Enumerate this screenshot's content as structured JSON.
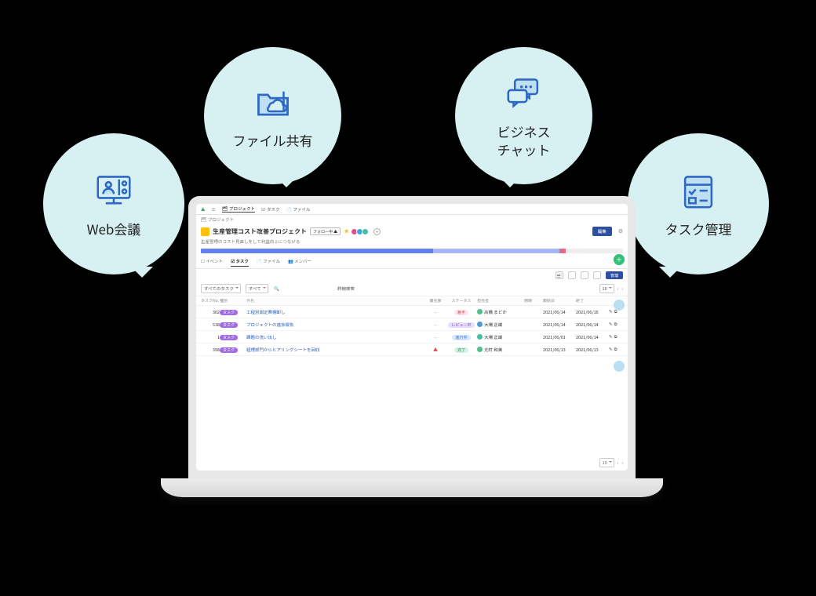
{
  "bubbles": {
    "web": "Web会議",
    "file": "ファイル共有",
    "chat": "ビジネス\nチャット",
    "task": "タスク管理"
  },
  "topnav": {
    "project": "プロジェクト",
    "task": "タスク",
    "file": "ファイル"
  },
  "breadcrumb": "プロジェクト",
  "project": {
    "title": "生産管理コスト改善プロジェクト",
    "follow_btn": "フォロー中 ▲",
    "description": "生産管理のコスト見直しをして利益向上につなげる",
    "edit_btn": "編集"
  },
  "subtabs": {
    "event": "イベント",
    "task": "タスク",
    "file": "ファイル",
    "member": "メンバー"
  },
  "toolbar": {
    "manage_btn": "管理"
  },
  "filters": {
    "task_filter": "すべてのタスク",
    "status_filter": "すべて",
    "detail_search": "詳細検索"
  },
  "pager": {
    "size": "10"
  },
  "columns": {
    "id": "タスクNo.",
    "type": "種別",
    "name": "件名",
    "priority": "優先度",
    "status": "ステータス",
    "assignee": "担当者",
    "due": "期限",
    "start": "開始日",
    "end": "終了",
    "actions": ""
  },
  "rows": [
    {
      "id": "302",
      "type": "タスク",
      "name": "工程別固定費棚卸し",
      "priority": "-",
      "status_key": "g",
      "status": "着手",
      "asg_color": "d-green",
      "assignee": "高橋 まどか",
      "due": "",
      "d1": "2021/06/14",
      "d2": "2021/06/16"
    },
    {
      "id": "538",
      "type": "タスク",
      "name": "プロジェクトの進捗報告",
      "priority": "-",
      "status_key": "r",
      "status": "レビュー中",
      "asg_color": "d-blue",
      "assignee": "大場 正雄",
      "due": "",
      "d1": "2021/06/14",
      "d2": "2021/06/14"
    },
    {
      "id": "1",
      "type": "タスク",
      "name": "課題の洗い出し",
      "priority": "-",
      "status_key": "c",
      "status": "進行中",
      "asg_color": "d-teal",
      "assignee": "大場 正雄",
      "due": "",
      "d1": "2021/06/01",
      "d2": "2021/06/14"
    },
    {
      "id": "398",
      "type": "タスク",
      "name": "経理部門からヒアリングシートを回収",
      "priority": "高",
      "status_key": "d",
      "status": "完了",
      "asg_color": "d-green",
      "assignee": "元村 和美",
      "due": "",
      "d1": "2021/06/13",
      "d2": "2021/06/13"
    }
  ]
}
